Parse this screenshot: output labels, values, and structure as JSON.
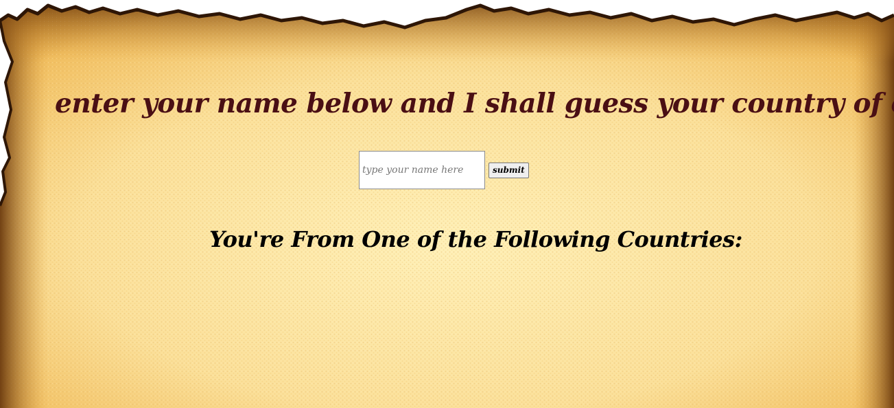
{
  "page": {
    "headline": "enter your name below and I shall guess your country of origin!",
    "results_heading": "You're From One of the Following Countries:"
  },
  "form": {
    "name_input": {
      "value": "",
      "placeholder": "type your name here"
    },
    "submit_label": "submit"
  },
  "results": {
    "countries": []
  },
  "colors": {
    "background": "#ffffff",
    "parchment_light": "#fdeaa8",
    "parchment_mid": "#f6cf6e",
    "burnt_edge": "#3a1e08",
    "headline_text": "#4a0f14",
    "heading_text": "#000000"
  }
}
